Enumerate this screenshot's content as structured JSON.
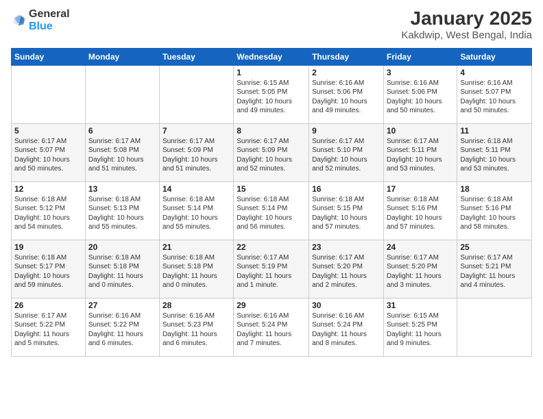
{
  "header": {
    "logo_general": "General",
    "logo_blue": "Blue",
    "main_title": "January 2025",
    "sub_title": "Kakdwip, West Bengal, India"
  },
  "weekdays": [
    "Sunday",
    "Monday",
    "Tuesday",
    "Wednesday",
    "Thursday",
    "Friday",
    "Saturday"
  ],
  "weeks": [
    [
      {
        "day": "",
        "info": ""
      },
      {
        "day": "",
        "info": ""
      },
      {
        "day": "",
        "info": ""
      },
      {
        "day": "1",
        "info": "Sunrise: 6:15 AM\nSunset: 5:05 PM\nDaylight: 10 hours\nand 49 minutes."
      },
      {
        "day": "2",
        "info": "Sunrise: 6:16 AM\nSunset: 5:06 PM\nDaylight: 10 hours\nand 49 minutes."
      },
      {
        "day": "3",
        "info": "Sunrise: 6:16 AM\nSunset: 5:06 PM\nDaylight: 10 hours\nand 50 minutes."
      },
      {
        "day": "4",
        "info": "Sunrise: 6:16 AM\nSunset: 5:07 PM\nDaylight: 10 hours\nand 50 minutes."
      }
    ],
    [
      {
        "day": "5",
        "info": "Sunrise: 6:17 AM\nSunset: 5:07 PM\nDaylight: 10 hours\nand 50 minutes."
      },
      {
        "day": "6",
        "info": "Sunrise: 6:17 AM\nSunset: 5:08 PM\nDaylight: 10 hours\nand 51 minutes."
      },
      {
        "day": "7",
        "info": "Sunrise: 6:17 AM\nSunset: 5:09 PM\nDaylight: 10 hours\nand 51 minutes."
      },
      {
        "day": "8",
        "info": "Sunrise: 6:17 AM\nSunset: 5:09 PM\nDaylight: 10 hours\nand 52 minutes."
      },
      {
        "day": "9",
        "info": "Sunrise: 6:17 AM\nSunset: 5:10 PM\nDaylight: 10 hours\nand 52 minutes."
      },
      {
        "day": "10",
        "info": "Sunrise: 6:17 AM\nSunset: 5:11 PM\nDaylight: 10 hours\nand 53 minutes."
      },
      {
        "day": "11",
        "info": "Sunrise: 6:18 AM\nSunset: 5:11 PM\nDaylight: 10 hours\nand 53 minutes."
      }
    ],
    [
      {
        "day": "12",
        "info": "Sunrise: 6:18 AM\nSunset: 5:12 PM\nDaylight: 10 hours\nand 54 minutes."
      },
      {
        "day": "13",
        "info": "Sunrise: 6:18 AM\nSunset: 5:13 PM\nDaylight: 10 hours\nand 55 minutes."
      },
      {
        "day": "14",
        "info": "Sunrise: 6:18 AM\nSunset: 5:14 PM\nDaylight: 10 hours\nand 55 minutes."
      },
      {
        "day": "15",
        "info": "Sunrise: 6:18 AM\nSunset: 5:14 PM\nDaylight: 10 hours\nand 56 minutes."
      },
      {
        "day": "16",
        "info": "Sunrise: 6:18 AM\nSunset: 5:15 PM\nDaylight: 10 hours\nand 57 minutes."
      },
      {
        "day": "17",
        "info": "Sunrise: 6:18 AM\nSunset: 5:16 PM\nDaylight: 10 hours\nand 57 minutes."
      },
      {
        "day": "18",
        "info": "Sunrise: 6:18 AM\nSunset: 5:16 PM\nDaylight: 10 hours\nand 58 minutes."
      }
    ],
    [
      {
        "day": "19",
        "info": "Sunrise: 6:18 AM\nSunset: 5:17 PM\nDaylight: 10 hours\nand 59 minutes."
      },
      {
        "day": "20",
        "info": "Sunrise: 6:18 AM\nSunset: 5:18 PM\nDaylight: 11 hours\nand 0 minutes."
      },
      {
        "day": "21",
        "info": "Sunrise: 6:18 AM\nSunset: 5:18 PM\nDaylight: 11 hours\nand 0 minutes."
      },
      {
        "day": "22",
        "info": "Sunrise: 6:17 AM\nSunset: 5:19 PM\nDaylight: 11 hours\nand 1 minute."
      },
      {
        "day": "23",
        "info": "Sunrise: 6:17 AM\nSunset: 5:20 PM\nDaylight: 11 hours\nand 2 minutes."
      },
      {
        "day": "24",
        "info": "Sunrise: 6:17 AM\nSunset: 5:20 PM\nDaylight: 11 hours\nand 3 minutes."
      },
      {
        "day": "25",
        "info": "Sunrise: 6:17 AM\nSunset: 5:21 PM\nDaylight: 11 hours\nand 4 minutes."
      }
    ],
    [
      {
        "day": "26",
        "info": "Sunrise: 6:17 AM\nSunset: 5:22 PM\nDaylight: 11 hours\nand 5 minutes."
      },
      {
        "day": "27",
        "info": "Sunrise: 6:16 AM\nSunset: 5:22 PM\nDaylight: 11 hours\nand 6 minutes."
      },
      {
        "day": "28",
        "info": "Sunrise: 6:16 AM\nSunset: 5:23 PM\nDaylight: 11 hours\nand 6 minutes."
      },
      {
        "day": "29",
        "info": "Sunrise: 6:16 AM\nSunset: 5:24 PM\nDaylight: 11 hours\nand 7 minutes."
      },
      {
        "day": "30",
        "info": "Sunrise: 6:16 AM\nSunset: 5:24 PM\nDaylight: 11 hours\nand 8 minutes."
      },
      {
        "day": "31",
        "info": "Sunrise: 6:15 AM\nSunset: 5:25 PM\nDaylight: 11 hours\nand 9 minutes."
      },
      {
        "day": "",
        "info": ""
      }
    ]
  ]
}
